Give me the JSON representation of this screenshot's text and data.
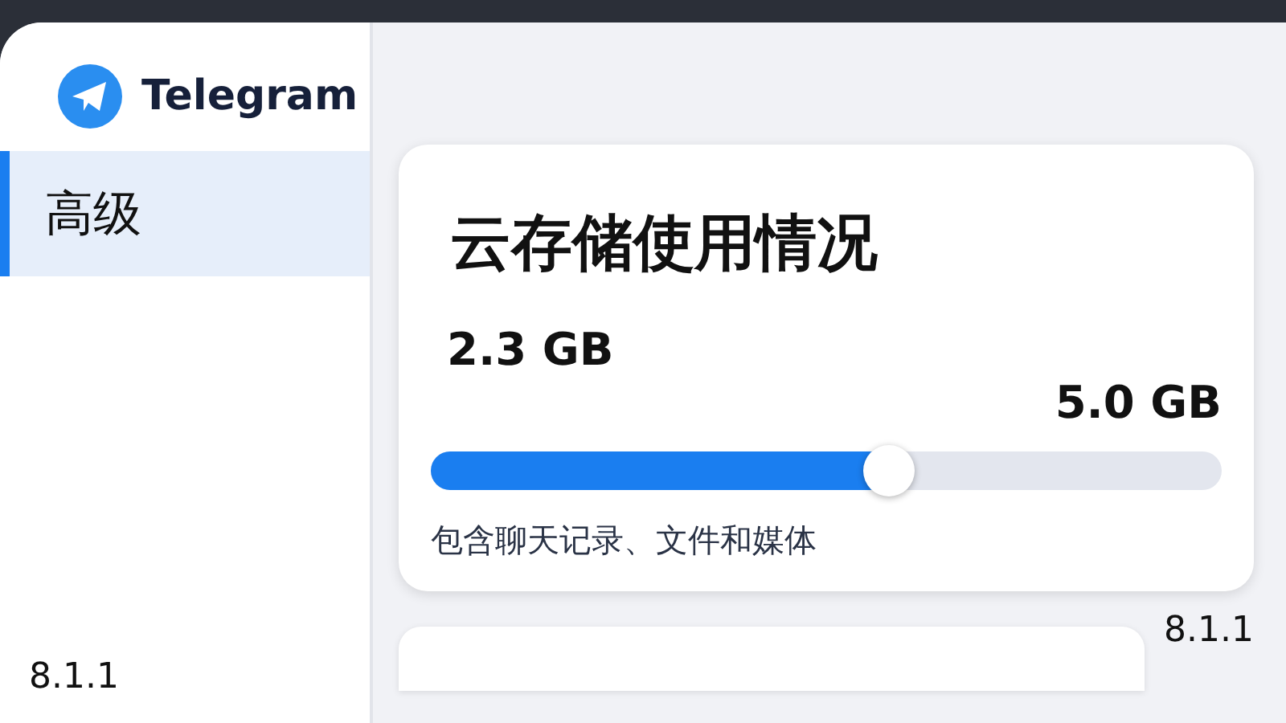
{
  "app": {
    "name": "Telegram"
  },
  "sidebar": {
    "items": [
      {
        "label": "高级",
        "selected": true
      }
    ],
    "version": "8.1.1"
  },
  "storage_card": {
    "title": "云存储使用情况",
    "used": "2.3 GB",
    "total": "5.0 GB",
    "level": 0.58,
    "description": "包含聊天记录、文件和媒体"
  },
  "footer": {
    "version": "8.1.1"
  }
}
